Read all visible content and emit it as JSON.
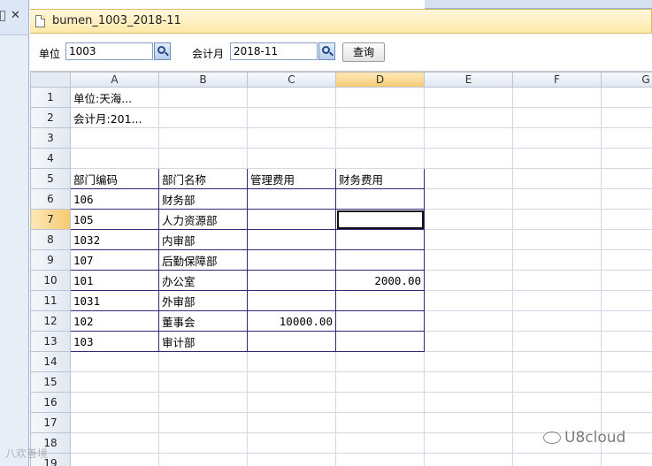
{
  "window": {
    "title": "bumen_1003_2018-11"
  },
  "toolbar": {
    "unit_label": "单位",
    "unit_value": "1003",
    "month_label": "会计月",
    "month_value": "2018-11",
    "query_label": "查询"
  },
  "sheet": {
    "columns": [
      "A",
      "B",
      "C",
      "D",
      "E",
      "F",
      "G"
    ],
    "selected_column": "D",
    "selected_row": 7,
    "rows": [
      {
        "n": "1",
        "a": "单位:天海...",
        "b": "",
        "c": "",
        "d": ""
      },
      {
        "n": "2",
        "a": "会计月:201...",
        "b": "",
        "c": "",
        "d": ""
      },
      {
        "n": "3",
        "a": "",
        "b": "",
        "c": "",
        "d": ""
      },
      {
        "n": "4",
        "a": "",
        "b": "",
        "c": "",
        "d": ""
      },
      {
        "n": "5",
        "a": "部门编码",
        "b": "部门名称",
        "c": "管理费用",
        "d": "财务费用"
      },
      {
        "n": "6",
        "a": "106",
        "b": "财务部",
        "c": "",
        "d": ""
      },
      {
        "n": "7",
        "a": "105",
        "b": "人力资源部",
        "c": "",
        "d": ""
      },
      {
        "n": "8",
        "a": "1032",
        "b": "内审部",
        "c": "",
        "d": ""
      },
      {
        "n": "9",
        "a": "107",
        "b": "后勤保障部",
        "c": "",
        "d": ""
      },
      {
        "n": "10",
        "a": "101",
        "b": "办公室",
        "c": "",
        "d": "2000.00"
      },
      {
        "n": "11",
        "a": "1031",
        "b": "外审部",
        "c": "",
        "d": ""
      },
      {
        "n": "12",
        "a": "102",
        "b": "董事会",
        "c": "10000.00",
        "d": ""
      },
      {
        "n": "13",
        "a": "103",
        "b": "审计部",
        "c": "",
        "d": ""
      },
      {
        "n": "14",
        "a": "",
        "b": "",
        "c": "",
        "d": ""
      },
      {
        "n": "15",
        "a": "",
        "b": "",
        "c": "",
        "d": ""
      },
      {
        "n": "16",
        "a": "",
        "b": "",
        "c": "",
        "d": ""
      },
      {
        "n": "17",
        "a": "",
        "b": "",
        "c": "",
        "d": ""
      },
      {
        "n": "18",
        "a": "",
        "b": "",
        "c": "",
        "d": ""
      },
      {
        "n": "19",
        "a": "",
        "b": "",
        "c": "",
        "d": ""
      }
    ]
  },
  "watermarks": {
    "left": "八欢善境",
    "right": "U8cloud"
  },
  "colors": {
    "title_bar": "#ffe9a8",
    "header_selected": "#f6c970",
    "table_border": "#2b2b7a"
  }
}
